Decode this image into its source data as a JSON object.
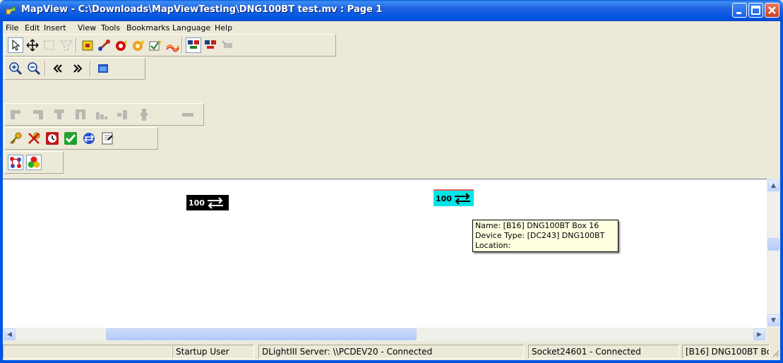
{
  "window": {
    "title": "MapView - C:\\Downloads\\MapViewTesting\\DNG100BT test.mv : Page 1"
  },
  "menu": [
    "File",
    "Edit",
    "Insert",
    "View",
    "Tools",
    "Bookmarks",
    "Language",
    "Help"
  ],
  "toolbar_icons": {
    "row1": [
      "pointer-tool-icon",
      "pan-tool-icon",
      "rectangle-select-icon",
      "polygon-select-icon",
      "add-panel-icon",
      "add-link-icon",
      "add-device-icon",
      "add-light-icon",
      "add-switch-icon",
      "add-wiring-icon",
      "network-device-icon",
      "network-remove-icon",
      "disabled-tool-icon"
    ],
    "row2": [
      "zoom-in-icon",
      "zoom-out-icon",
      "previous-icon",
      "next-icon",
      "window-icon"
    ],
    "row3": [
      "align-left-icon",
      "align-right-icon",
      "align-top-icon",
      "align-bottom-icon",
      "distribute-icon",
      "distribute-horizontal-icon",
      "distribute-vertical-icon",
      "arrange-icon"
    ],
    "row4": [
      "key-icon",
      "key-remove-icon",
      "clock-icon",
      "check-icon",
      "network-refresh-icon",
      "properties-icon"
    ],
    "row5": [
      "connections-icon",
      "color-groups-icon"
    ]
  },
  "devices": [
    {
      "label": "100",
      "color": "#000000"
    },
    {
      "label": "100",
      "color": "#00e5e5"
    }
  ],
  "tooltip": {
    "name": "Name: [B16] DNG100BT Box 16",
    "device_type": "Device Type: [DC243] DNG100BT",
    "location": "Location:"
  },
  "status": {
    "user": "Startup User",
    "server": "DLightIII Server: \\\\PCDEV20  - Connected",
    "socket": "Socket24601 - Connected",
    "device": "[B16] DNG100BT Bo"
  }
}
